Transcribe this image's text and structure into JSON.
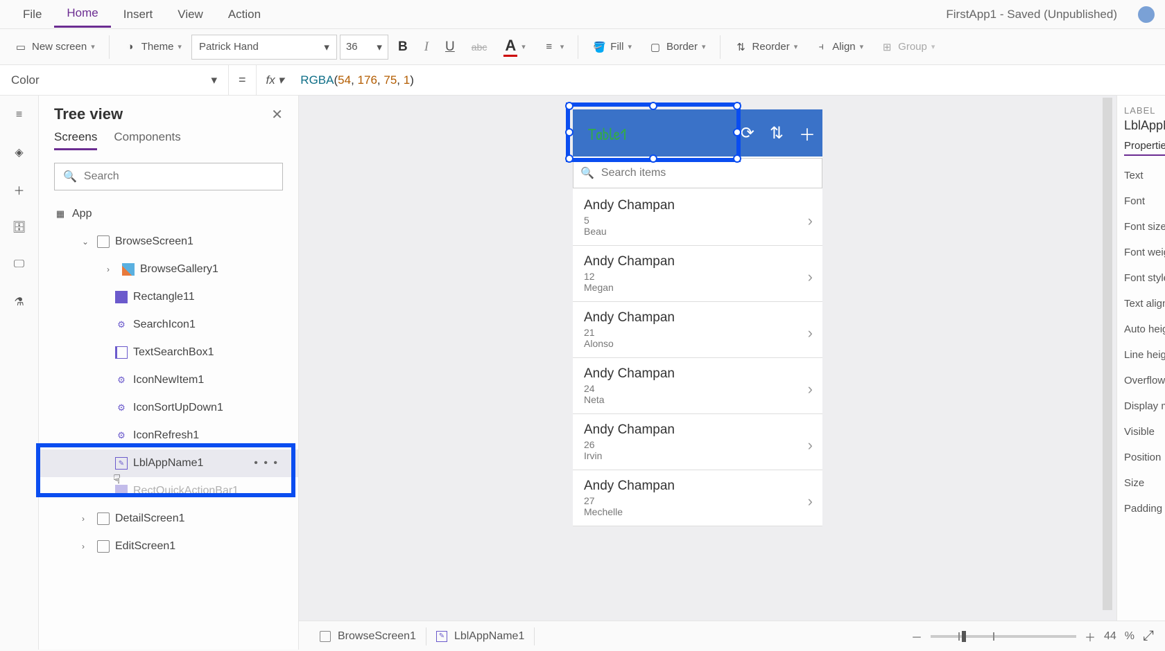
{
  "menu": {
    "file": "File",
    "home": "Home",
    "insert": "Insert",
    "view": "View",
    "action": "Action"
  },
  "appStatus": "FirstApp1 - Saved (Unpublished)",
  "ribbon": {
    "newScreen": "New screen",
    "theme": "Theme",
    "font": "Patrick Hand",
    "fontSize": "36",
    "fill": "Fill",
    "border": "Border",
    "reorder": "Reorder",
    "align": "Align",
    "group": "Group"
  },
  "formula": {
    "property": "Color",
    "fn": "RGBA",
    "a": "54",
    "b": "176",
    "c": "75",
    "d": "1"
  },
  "tree": {
    "title": "Tree view",
    "tabScreens": "Screens",
    "tabComponents": "Components",
    "searchPlaceholder": "Search",
    "app": "App",
    "items": [
      {
        "label": "BrowseScreen1"
      },
      {
        "label": "BrowseGallery1"
      },
      {
        "label": "Rectangle11"
      },
      {
        "label": "SearchIcon1"
      },
      {
        "label": "TextSearchBox1"
      },
      {
        "label": "IconNewItem1"
      },
      {
        "label": "IconSortUpDown1"
      },
      {
        "label": "IconRefresh1"
      },
      {
        "label": "LblAppName1"
      },
      {
        "label": "RectQuickActionBar1"
      },
      {
        "label": "DetailScreen1"
      },
      {
        "label": "EditScreen1"
      }
    ]
  },
  "phone": {
    "title": "Table1",
    "searchPlaceholder": "Search items",
    "rows": [
      {
        "name": "Andy Champan",
        "num": "5",
        "sub": "Beau"
      },
      {
        "name": "Andy Champan",
        "num": "12",
        "sub": "Megan"
      },
      {
        "name": "Andy Champan",
        "num": "21",
        "sub": "Alonso"
      },
      {
        "name": "Andy Champan",
        "num": "24",
        "sub": "Neta"
      },
      {
        "name": "Andy Champan",
        "num": "26",
        "sub": "Irvin"
      },
      {
        "name": "Andy Champan",
        "num": "27",
        "sub": "Mechelle"
      }
    ]
  },
  "props": {
    "category": "LABEL",
    "name": "LblAppN",
    "tab": "Propertie",
    "rows": [
      "Text",
      "Font",
      "Font size",
      "Font weig",
      "Font style",
      "Text align",
      "Auto heig",
      "Line heigh",
      "Overflow",
      "Display m",
      "Visible",
      "Position",
      "Size",
      "Padding"
    ]
  },
  "breadcrumb": {
    "screen": "BrowseScreen1",
    "control": "LblAppName1"
  },
  "zoom": {
    "value": "44",
    "unit": "%"
  }
}
